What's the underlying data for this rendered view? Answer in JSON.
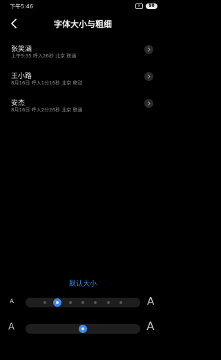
{
  "status_bar": {
    "time": "下午5:46",
    "icon_box": "×",
    "battery": "90",
    "icons": [
      "screen-record-icon",
      "battery-icon"
    ]
  },
  "header": {
    "title": "字体大小与粗细",
    "back_icon": "chevron-left-icon"
  },
  "contacts": [
    {
      "name": "张笑涵",
      "detail": "上午9:35  呼入26秒  北京 联通"
    },
    {
      "name": "王小路",
      "detail": "8月16日  呼入1分16秒  北京 移动"
    },
    {
      "name": "安杰",
      "detail": "8月16日  呼入2分26秒  北京 联通"
    }
  ],
  "default_size_label": "默认大小",
  "font_size_slider": {
    "min_label": "A",
    "max_label": "A",
    "steps": 7,
    "value_index": 1
  },
  "font_weight_slider": {
    "min_label": "A",
    "max_label": "A",
    "value": 0.5
  },
  "colors": {
    "accent": "#3d8bea",
    "background": "#000000",
    "secondary_text": "#8a8a8a"
  }
}
